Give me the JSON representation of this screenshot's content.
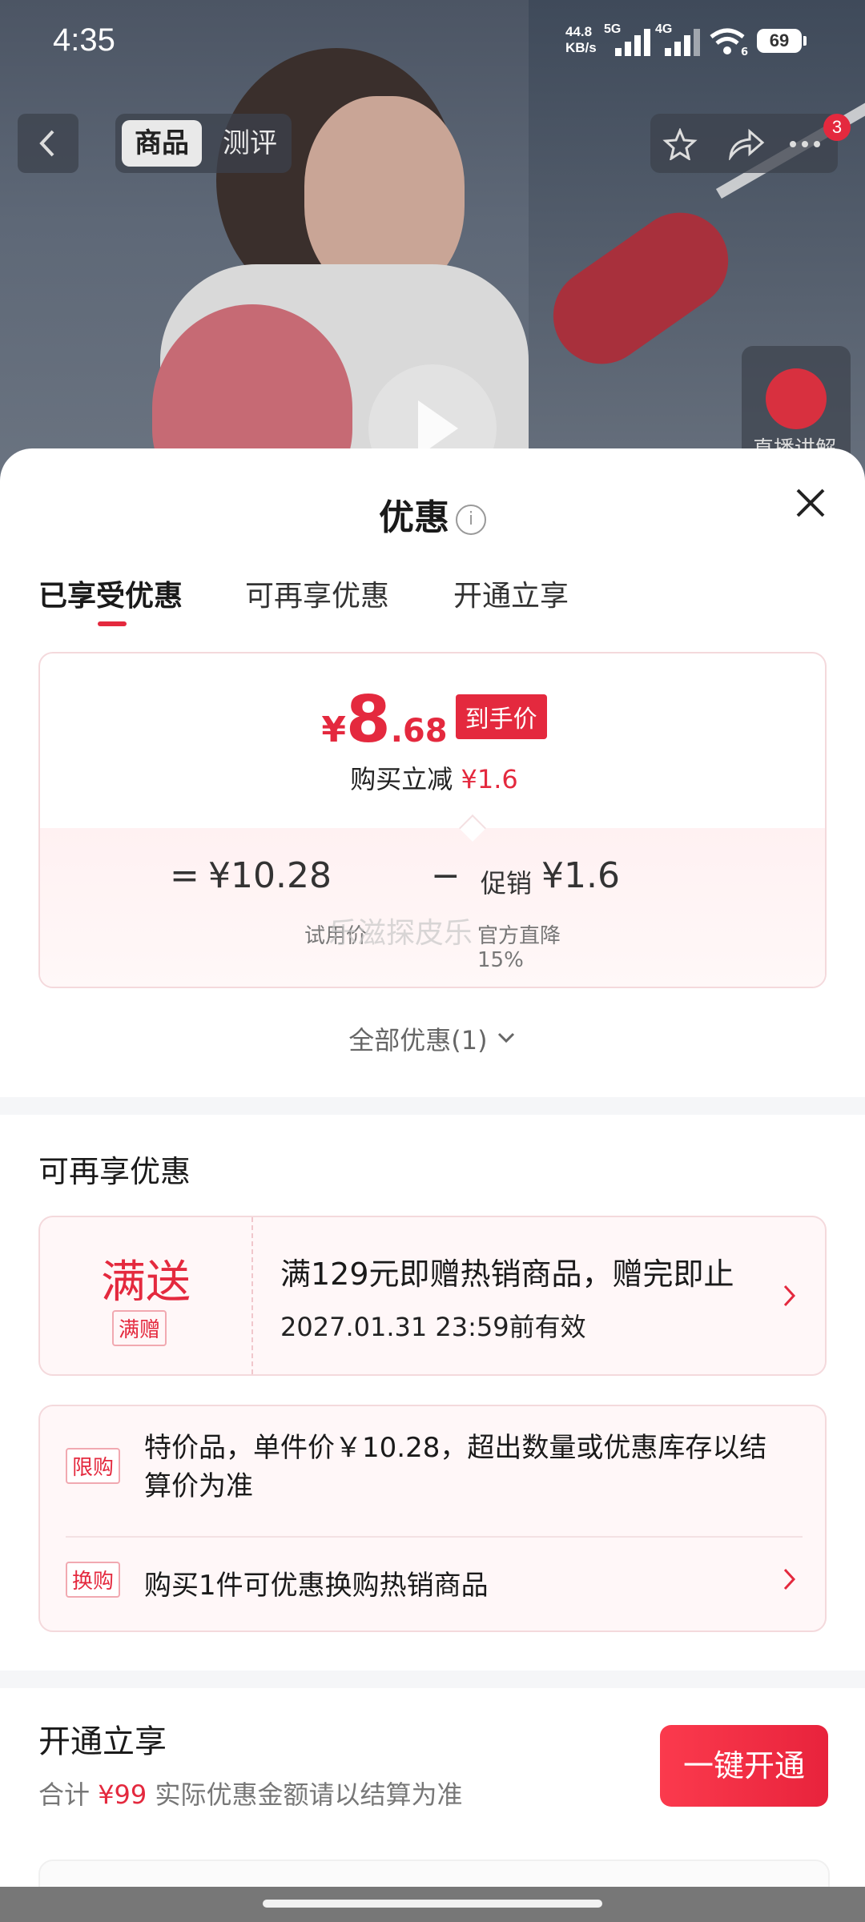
{
  "status_bar": {
    "time": "4:35",
    "net_speed_value": "44.8",
    "net_speed_unit": "KB/s",
    "signal1_label": "5G",
    "signal2_label": "4G",
    "wifi_sub": "6",
    "battery": "69"
  },
  "nav": {
    "tab_product": "商品",
    "tab_review": "测评",
    "notification_count": "3",
    "live_label": "直播讲解"
  },
  "sheet": {
    "title": "优惠",
    "info_icon": "i",
    "tabs": [
      "已享受优惠",
      "可再享优惠",
      "开通立享"
    ],
    "active_tab": 0
  },
  "price_card": {
    "currency": "¥",
    "price_int": "8",
    "price_dec": ".68",
    "price_tag": "到手价",
    "saving_label": "购买立减",
    "saving_amount": "¥1.6",
    "eq_sign": "=",
    "trial_price": "¥10.28",
    "trial_price_label": "试用价",
    "minus_sign": "−",
    "promo_prefix": "促销",
    "promo_amount": "¥1.6",
    "promo_label": "官方直降",
    "promo_percent": "15%",
    "watermark": "乐滋探皮乐"
  },
  "all_offers": "全部优惠(1)",
  "more_offers": {
    "title": "可再享优惠",
    "gift": {
      "big": "满送",
      "tag": "满赠",
      "desc": "满129元即赠热销商品，赠完即止",
      "validity": "2027.01.31 23:59前有效"
    },
    "limit": {
      "tag1": "限购",
      "text1": "特价品，单件价￥10.28，超出数量或优惠库存以结算价为准",
      "tag2": "换购",
      "text2": "购买1件可优惠换购热销商品"
    }
  },
  "open_section": {
    "title": "开通立享",
    "sub_prefix": "合计",
    "sub_amount": "¥99",
    "sub_suffix": "实际优惠金额请以结算为准",
    "button": "一键开通"
  },
  "colors": {
    "accent": "#e4293e",
    "card_border": "#f4d9dc",
    "card_bg": "#fff7f8"
  }
}
